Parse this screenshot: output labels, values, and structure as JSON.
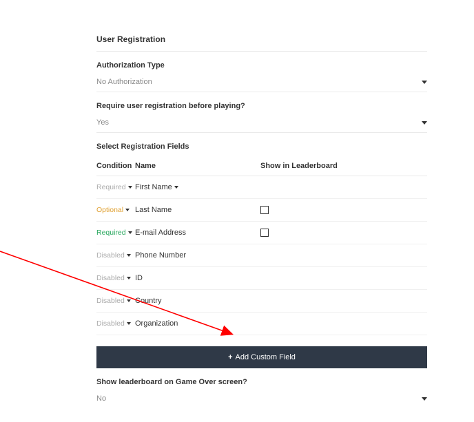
{
  "section_title": "User Registration",
  "auth": {
    "label": "Authorization Type",
    "value": "No Authorization"
  },
  "require_reg": {
    "label": "Require user registration before playing?",
    "value": "Yes"
  },
  "fields_section_label": "Select Registration Fields",
  "headers": {
    "condition": "Condition",
    "name": "Name",
    "show": "Show in Leaderboard"
  },
  "rows": [
    {
      "condition": "Required",
      "cond_class": "cond-disabled",
      "name": "First Name",
      "name_has_caret": true,
      "show_checkbox": false
    },
    {
      "condition": "Optional",
      "cond_class": "cond-optional",
      "name": "Last Name",
      "name_has_caret": false,
      "show_checkbox": true
    },
    {
      "condition": "Required",
      "cond_class": "cond-required",
      "name": "E-mail Address",
      "name_has_caret": false,
      "show_checkbox": true
    },
    {
      "condition": "Disabled",
      "cond_class": "cond-disabled",
      "name": "Phone Number",
      "name_has_caret": false,
      "show_checkbox": false
    },
    {
      "condition": "Disabled",
      "cond_class": "cond-disabled",
      "name": "ID",
      "name_has_caret": false,
      "show_checkbox": false
    },
    {
      "condition": "Disabled",
      "cond_class": "cond-disabled",
      "name": "Country",
      "name_has_caret": false,
      "show_checkbox": false
    },
    {
      "condition": "Disabled",
      "cond_class": "cond-disabled",
      "name": "Organization",
      "name_has_caret": false,
      "show_checkbox": false
    }
  ],
  "add_button": "Add Custom Field",
  "leaderboard": {
    "label": "Show leaderboard on Game Over screen?",
    "value": "No"
  }
}
